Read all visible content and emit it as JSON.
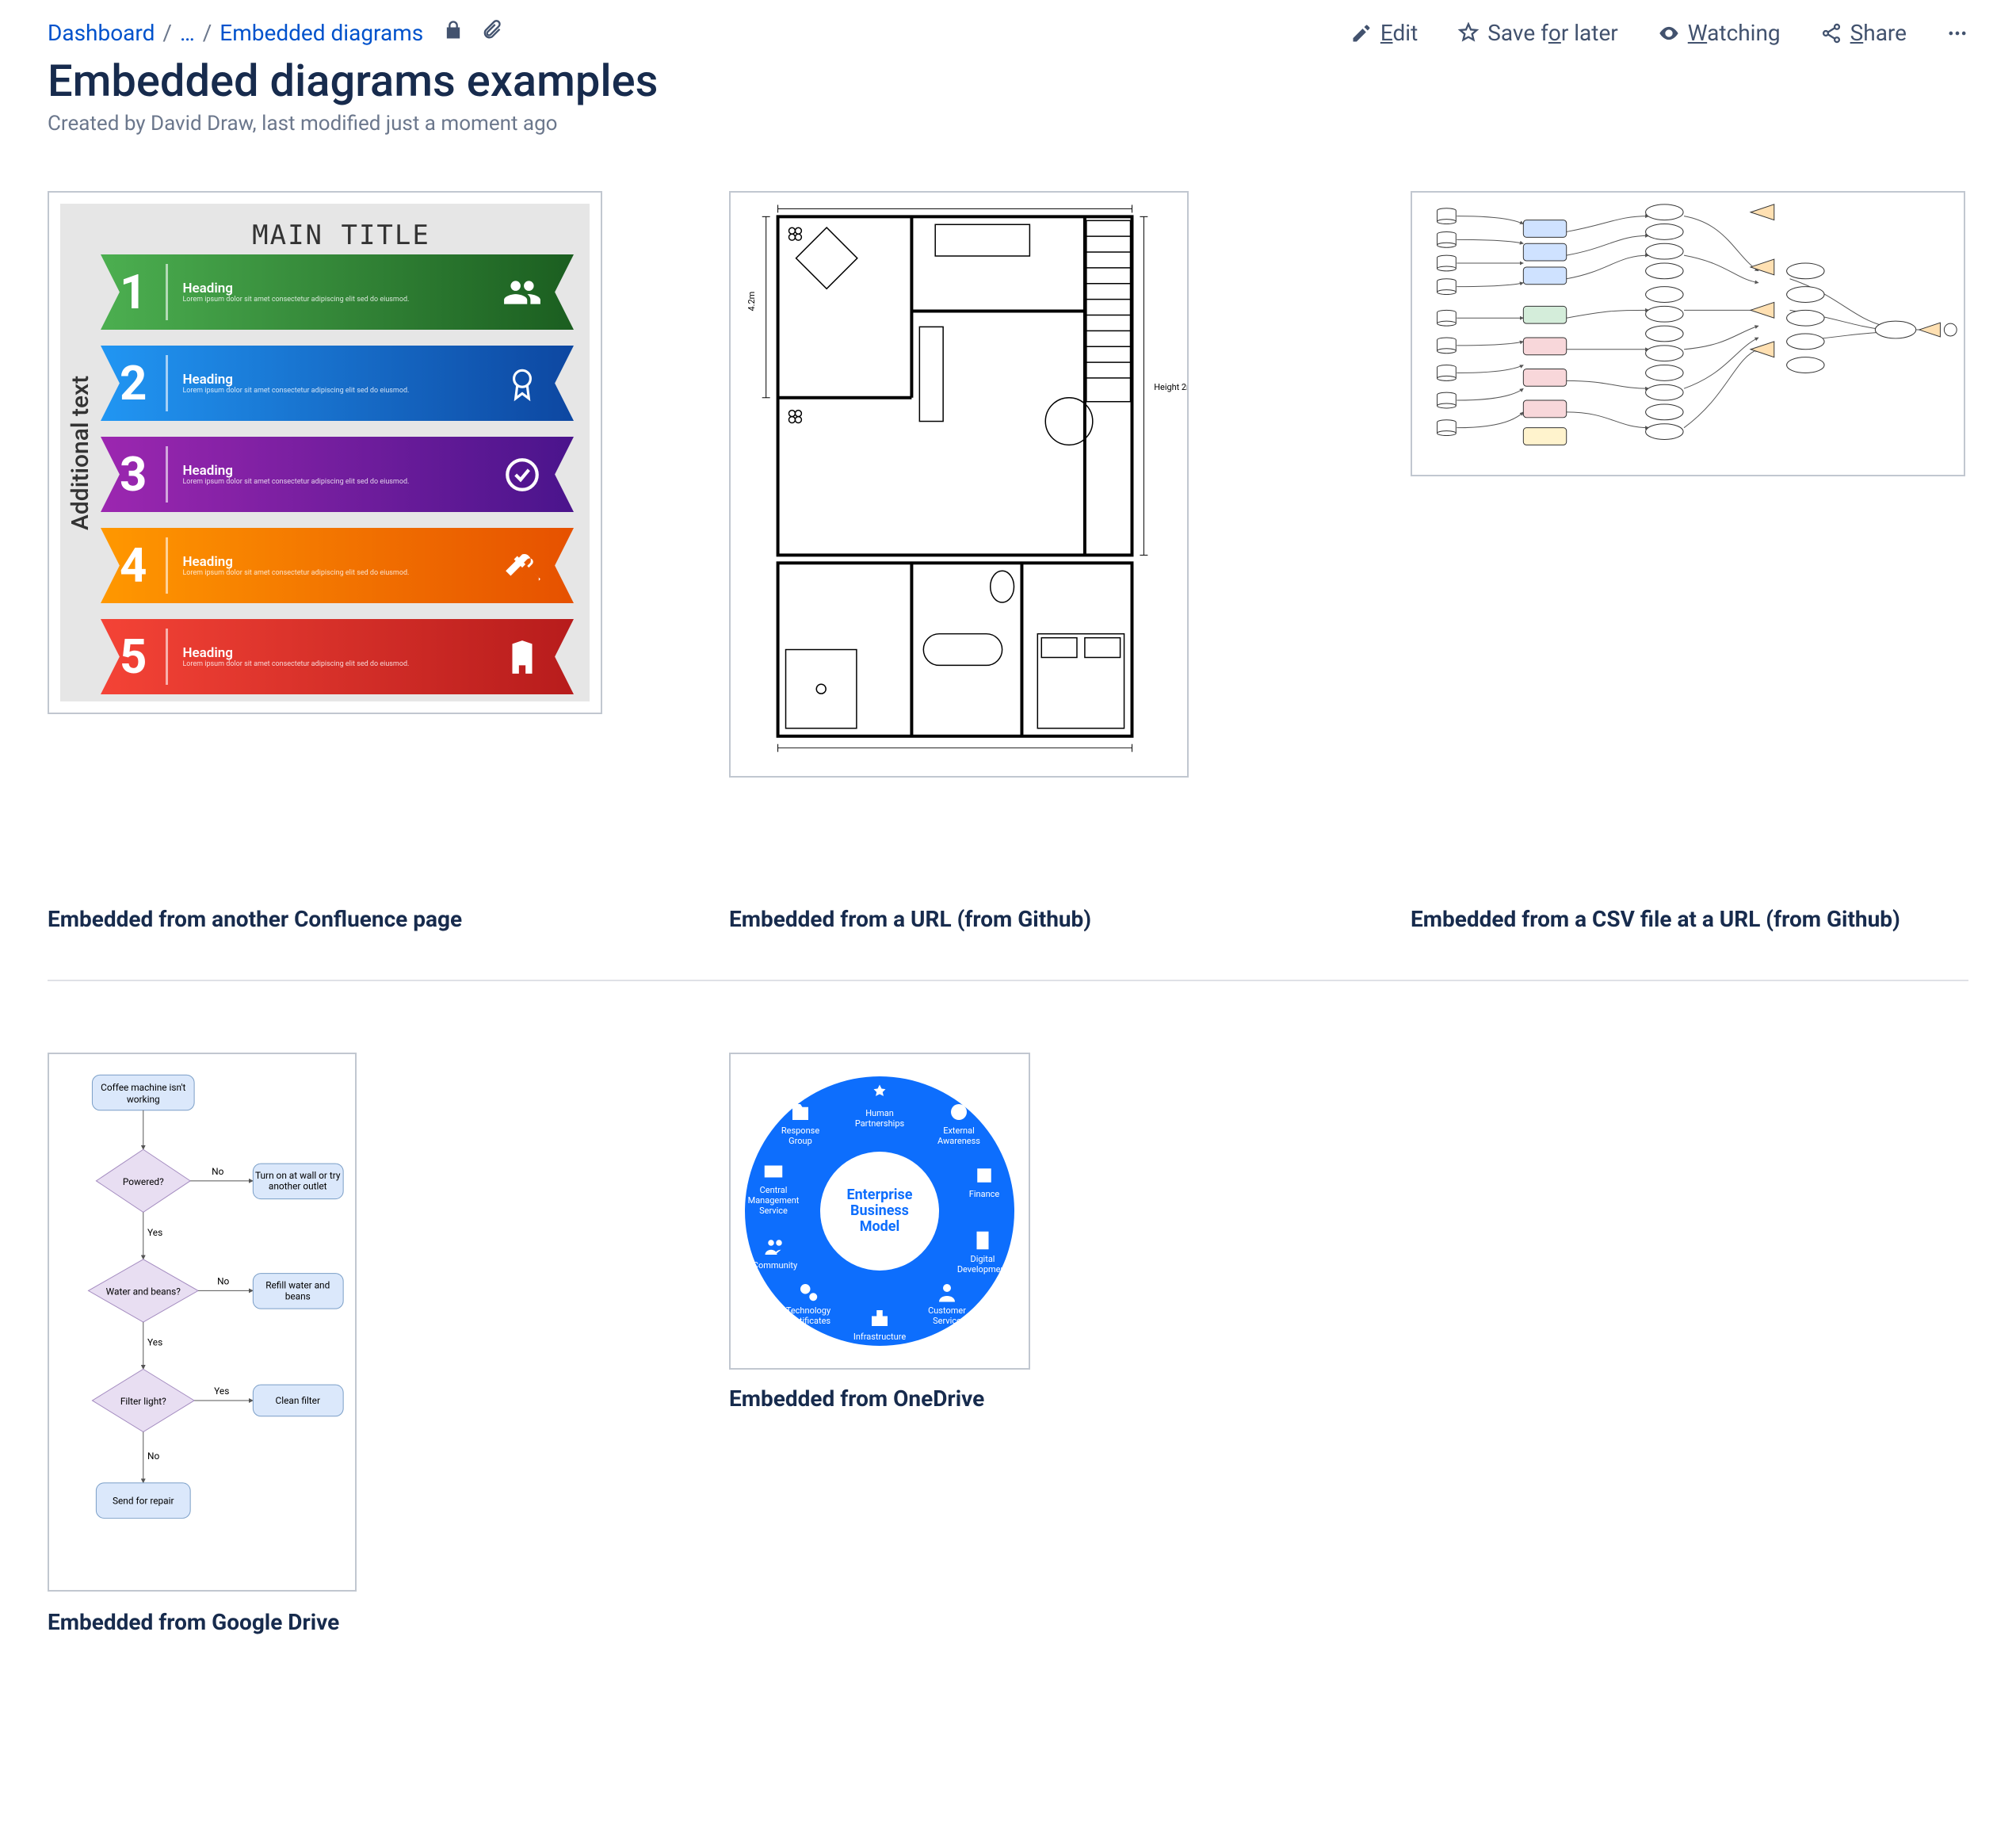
{
  "breadcrumbs": {
    "dashboard": "Dashboard",
    "ellipsis": "…",
    "current": "Embedded diagrams"
  },
  "actions": {
    "edit": "Edit",
    "save": "Save for later",
    "watching": "Watching",
    "share": "Share"
  },
  "page": {
    "title": "Embedded diagrams examples",
    "meta": "Created by David Draw, last modified just a moment ago"
  },
  "thumbs": {
    "t1": {
      "caption": "Embedded from another Confluence page",
      "title": "MAIN TITLE",
      "side": "Additional text",
      "rows": [
        {
          "n": "1",
          "h": "Heading"
        },
        {
          "n": "2",
          "h": "Heading"
        },
        {
          "n": "3",
          "h": "Heading"
        },
        {
          "n": "4",
          "h": "Heading"
        },
        {
          "n": "5",
          "h": "Heading"
        }
      ]
    },
    "t2": {
      "caption": "Embedded from a URL (from Github)"
    },
    "t3": {
      "caption": "Embedded from a CSV file at a URL (from Github)"
    },
    "t4": {
      "caption": "Embedded from Google Drive",
      "nodes": {
        "start": "Coffee machine isn't working",
        "d1": "Powered?",
        "a1": "Turn on at wall or try another outlet",
        "d2": "Water and beans?",
        "a2": "Refill water and beans",
        "d3": "Filter light?",
        "a3": "Clean filter",
        "end": "Send for repair",
        "yes": "Yes",
        "no": "No"
      }
    },
    "t5": {
      "caption": "Embedded from OneDrive",
      "center1": "Enterprise",
      "center2": "Business",
      "center3": "Model",
      "segs": [
        "Human Partnerships",
        "External Awareness",
        "Finance",
        "Digital Development",
        "Customer Service",
        "Infrastructure",
        "Technology Certificates",
        "Community",
        "Central Management Service",
        "Response Group"
      ]
    }
  }
}
